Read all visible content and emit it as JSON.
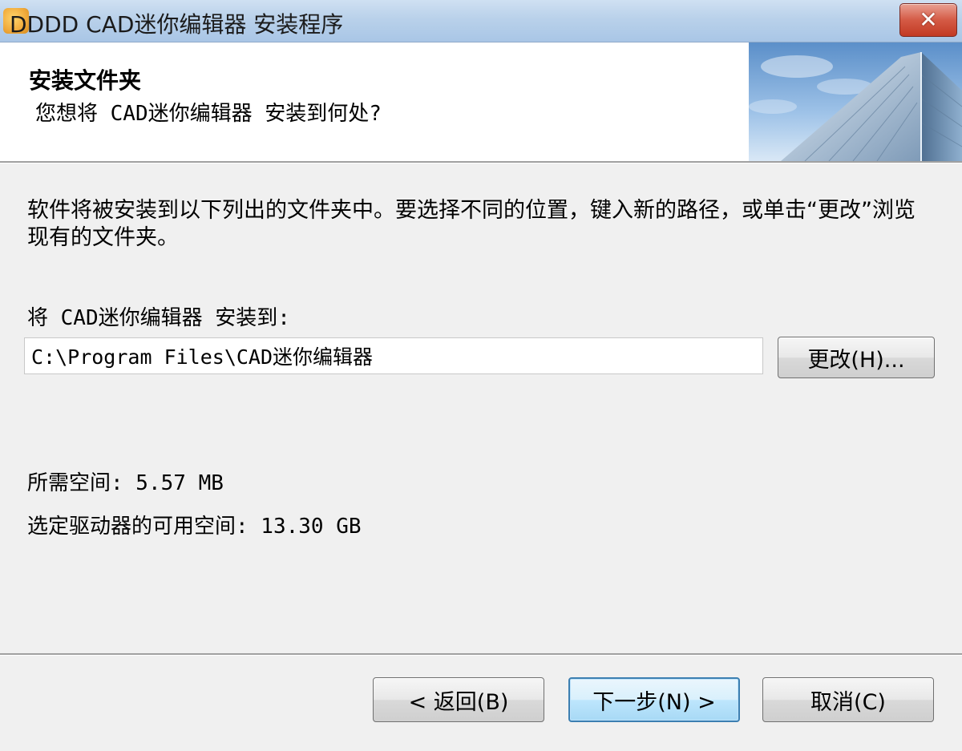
{
  "window": {
    "title": "DDDD CAD迷你编辑器 安装程序",
    "close_label": "✕"
  },
  "header": {
    "title": "安装文件夹",
    "subtitle": "您想将 CAD迷你编辑器 安装到何处?"
  },
  "body": {
    "description": "软件将被安装到以下列出的文件夹中。要选择不同的位置，键入新的路径，或单击“更改”浏览现有的文件夹。",
    "install_label": "将 CAD迷你编辑器 安装到:",
    "install_path": "C:\\Program Files\\CAD迷你编辑器",
    "change_button": "更改(H)...",
    "space_required": "所需空间: 5.57 MB",
    "space_available": "选定驱动器的可用空间: 13.30 GB"
  },
  "footer": {
    "back_button": "< 返回(B)",
    "next_button": "下一步(N) >",
    "cancel_button": "取消(C)"
  },
  "colors": {
    "titlebar": "#b9d1ea",
    "close_button": "#c23a24",
    "background": "#f0f0f0",
    "default_button_border": "#3c7fb1"
  },
  "icons": {
    "app": "app-icon",
    "close": "close-icon",
    "header_image": "building-image"
  }
}
